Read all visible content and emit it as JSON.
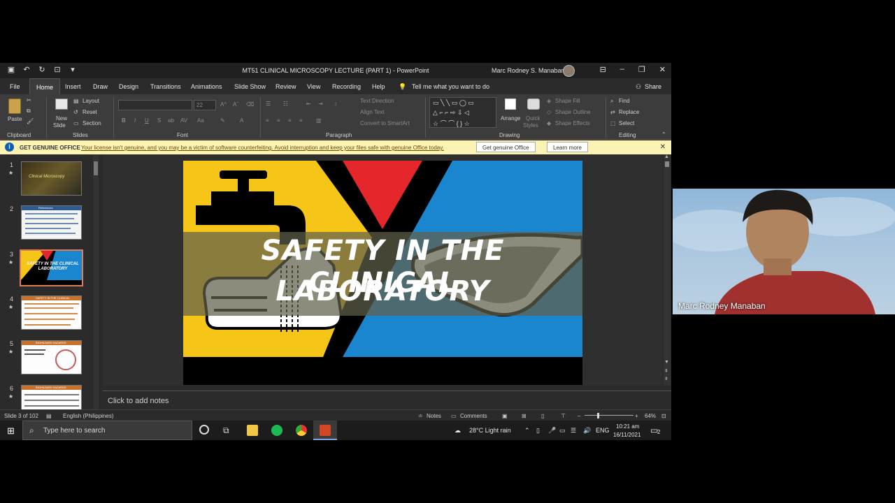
{
  "window": {
    "title": "MT51 CLINICAL MICROSCOPY LECTURE (PART 1)  -  PowerPoint",
    "user_name": "Marc Rodney S. Manaban"
  },
  "ribbon_tabs": [
    "File",
    "Home",
    "Insert",
    "Draw",
    "Design",
    "Transitions",
    "Animations",
    "Slide Show",
    "Review",
    "View",
    "Recording",
    "Help"
  ],
  "tell_me": "Tell me what you want to do",
  "share": "Share",
  "ribbon": {
    "clipboard": {
      "paste": "Paste",
      "label": "Clipboard"
    },
    "slides": {
      "new_slide": "New",
      "new_slide2": "Slide",
      "layout": "Layout",
      "reset": "Reset",
      "section": "Section",
      "label": "Slides"
    },
    "font": {
      "size": "22",
      "label": "Font"
    },
    "paragraph": {
      "text_direction": "Text Direction",
      "align_text": "Align Text",
      "convert": "Convert to SmartArt",
      "label": "Paragraph"
    },
    "drawing": {
      "arrange": "Arrange",
      "quick_styles": "Quick",
      "quick_styles2": "Styles",
      "shape_fill": "Shape Fill",
      "shape_outline": "Shape Outline",
      "shape_effects": "Shape Effects",
      "label": "Drawing"
    },
    "editing": {
      "find": "Find",
      "replace": "Replace",
      "select": "Select",
      "label": "Editing"
    }
  },
  "infobar": {
    "title": "GET GENUINE OFFICE",
    "message": "Your license isn't genuine, and you may be a victim of software counterfeiting. Avoid interruption and keep your files safe with genuine Office today.",
    "btn_genuine": "Get genuine Office",
    "btn_learn": "Learn more"
  },
  "thumbnails": [
    {
      "num": "1",
      "star": "★",
      "title": "Clinical Microscopy"
    },
    {
      "num": "2",
      "star": "",
      "title": "References"
    },
    {
      "num": "3",
      "star": "★",
      "title": "SAFETY IN THE CLINICAL LABORATORY"
    },
    {
      "num": "4",
      "star": "★",
      "title": "SAFETY IN THE CLINICAL"
    },
    {
      "num": "5",
      "star": "★",
      "title": "BIOHAZARD HAZARDS"
    },
    {
      "num": "6",
      "star": "★",
      "title": "BIOHAZARD HAZARDS"
    }
  ],
  "slide": {
    "title_line1": "SAFETY IN THE CLINICAL",
    "title_line2": "LABORATORY",
    "colors": {
      "yellow": "#f5c518",
      "red": "#e5262b",
      "blue": "#1a86d0",
      "black": "#000000"
    }
  },
  "notes_placeholder": "Click to add notes",
  "status": {
    "slide_count": "Slide 3 of 102",
    "language": "English (Philippines)",
    "notes": "Notes",
    "comments": "Comments",
    "zoom": "64%"
  },
  "taskbar": {
    "search_placeholder": "Type here to search",
    "weather": "28°C  Light rain",
    "lang": "ENG",
    "time": "10:21 am",
    "date": "16/11/2021",
    "notifications": "2"
  },
  "webcam": {
    "name": "Marc Rodney Manaban"
  }
}
